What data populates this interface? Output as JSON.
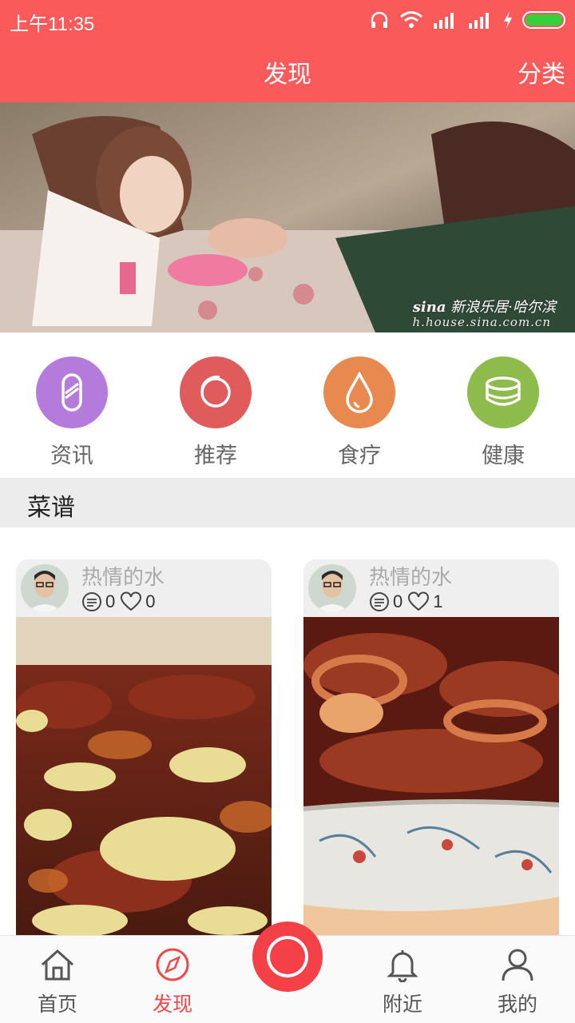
{
  "status_bar": {
    "time": "上午11:35"
  },
  "header": {
    "title": "发现",
    "right_action": "分类"
  },
  "banner": {
    "watermark_brand": "sina",
    "watermark_text": "新浪乐居·哈尔滨",
    "watermark_url": "h.house.sina.com.cn"
  },
  "categories": [
    {
      "label": "资讯",
      "icon": "capsule-icon",
      "color": "#b57bdc"
    },
    {
      "label": "推荐",
      "icon": "ring-icon",
      "color": "#e05c5c"
    },
    {
      "label": "食疗",
      "icon": "droplet-icon",
      "color": "#e8894f"
    },
    {
      "label": "健康",
      "icon": "bowl-icon",
      "color": "#8dbb4c"
    }
  ],
  "section": {
    "title": "菜谱"
  },
  "cards": [
    {
      "user": "热情的水",
      "comments": "0",
      "likes": "0"
    },
    {
      "user": "热情的水",
      "comments": "0",
      "likes": "1"
    }
  ],
  "bottom_nav": {
    "items": [
      {
        "label": "首页",
        "icon": "home-icon"
      },
      {
        "label": "发现",
        "icon": "compass-icon",
        "active": true
      },
      {
        "label": "附近",
        "icon": "bell-icon"
      },
      {
        "label": "我的",
        "icon": "user-icon"
      }
    ],
    "center_icon": "record-icon"
  },
  "colors": {
    "primary": "#fa5a5a",
    "accent_active": "#f04848",
    "section_bg": "#ececec"
  }
}
